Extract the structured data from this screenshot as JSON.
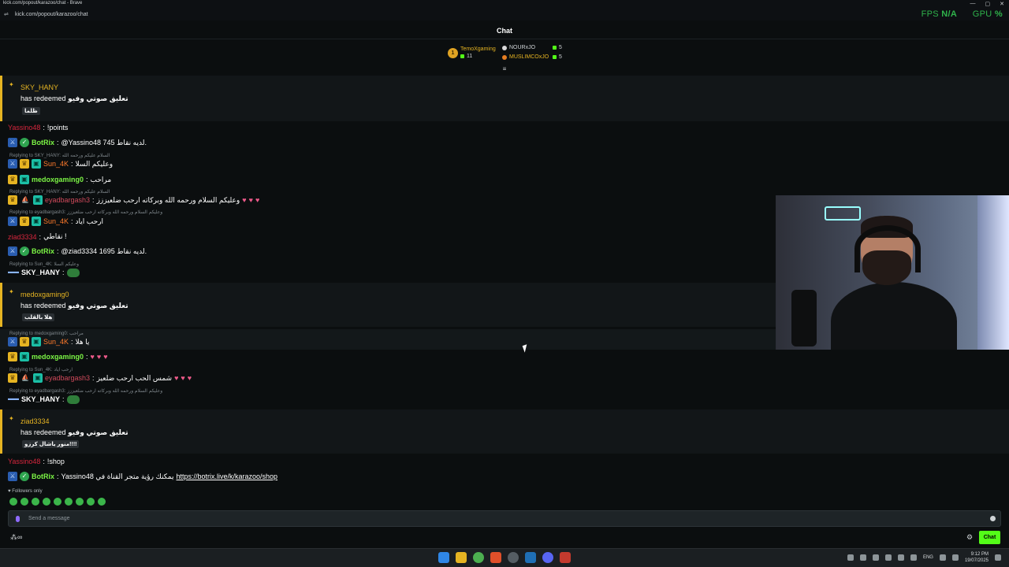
{
  "browser": {
    "title": "kick.com/popout/karazoo/chat - Brave",
    "url": "kick.com/popout/karazoo/chat"
  },
  "overlay": {
    "fps_label": "FPS",
    "fps_value": "N/A",
    "gpu_label": "GPU",
    "gpu_value": "%"
  },
  "chat": {
    "title": "Chat"
  },
  "leaderboard": {
    "rank": "1",
    "top_user": "TemoXgaming",
    "top_count": "11",
    "second_user": "NOURxJO",
    "second_count": "5",
    "third_user": "MUSLIMCOxJO",
    "third_count": "5"
  },
  "messages": [
    {
      "type": "redeem",
      "user": "SKY_HANY",
      "text": "has redeemed",
      "reward": "تعليق صوتي وفيو",
      "note": "ظلما"
    },
    {
      "user": "Yassino48",
      "text": "!points"
    },
    {
      "user": "BotRix",
      "text": "@Yassino48 لديه نقاط 745."
    },
    {
      "reply_to": "Replying to SKY_HANY: السلام عليكم ورحمه الله",
      "user": "Sun_4K",
      "text": "وعليكم السلا"
    },
    {
      "user": "medoxgaming0",
      "text": "مراحب"
    },
    {
      "reply_to": "Replying to SKY_HANY: السلام عليكم ورحمه الله",
      "user": "eyadbargash3",
      "text": "وعليكم السلام ورحمه الله وبركاته ارحب ضلعيززز"
    },
    {
      "reply_to": "Replying to eyadbargash3: وعليكم السلام ورحمه الله وبركاته ارحب ضلعيززز",
      "user": "Sun_4K",
      "text": "ارحب اياد"
    },
    {
      "user": "ziad3334",
      "text": "نقاطي !"
    },
    {
      "user": "BotRix",
      "text": "@ziad3334 لديه نقاط 1695."
    },
    {
      "reply_to": "Replying to Sun_4K: وعليكم السلا",
      "user": "SKY_HANY",
      "text": ""
    },
    {
      "type": "redeem",
      "user": "medoxgaming0",
      "text": "has redeemed",
      "reward": "تعليق صوتي وفيو",
      "note": "هلا بالقلب"
    },
    {
      "reply_to": "Replying to medoxgaming0: مراحب",
      "user": "Sun_4K",
      "text": "يا هلا"
    },
    {
      "user": "medoxgaming0",
      "text": ""
    },
    {
      "reply_to": "Replying to Sun_4K: ارحب اياد",
      "user": "eyadbargash3",
      "text": "شمس الحب ارحب ضلعيز"
    },
    {
      "reply_to": "Replying to eyadbargash3: وعليكم السلام ورحمه الله وبركاته ارحب ضلعيززز",
      "user": "SKY_HANY",
      "text": ""
    },
    {
      "type": "redeem",
      "user": "ziad3334",
      "text": "has redeemed",
      "reward": "تعليق صوتي وفيو",
      "note": "منور ياشال كرزو!!!!"
    },
    {
      "user": "Yassino48",
      "text": "!shop"
    },
    {
      "user": "BotRix",
      "text": "Yassino48 يمكنك رؤية متجر القناة في",
      "link": "https://botrix.live/k/karazoo/shop"
    }
  ],
  "footer": {
    "followers_only": "Followers only",
    "input_placeholder": "Send a message",
    "chat_button": "Chat"
  },
  "taskbar": {
    "lang": "ENG",
    "time": "9:12 PM",
    "date": "19/07/2025"
  }
}
